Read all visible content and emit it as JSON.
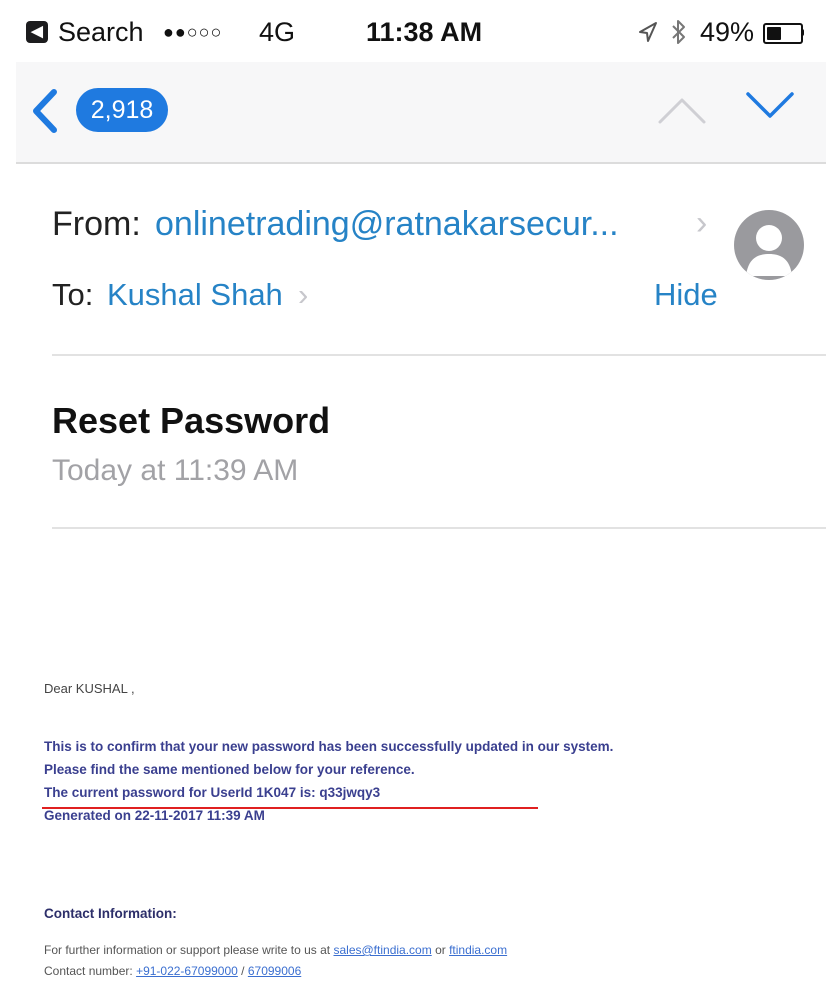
{
  "status_bar": {
    "back_app_glyph": "◀",
    "back_app_label": "Search",
    "signal_dots": "●●○○○",
    "network": "4G",
    "time": "11:38 AM",
    "battery_percent": "49%",
    "battery_level": 0.49,
    "icons": [
      "location-arrow-icon",
      "bluetooth-icon",
      "battery-icon"
    ]
  },
  "nav": {
    "back_count": "2,918",
    "icons": [
      "back-chevron-icon",
      "up-chevron-icon",
      "down-chevron-icon"
    ]
  },
  "email": {
    "from_label": "From:",
    "from_address": "onlinetrading@ratnakarsecur...",
    "from_chevron": "›",
    "to_label": "To:",
    "to_name": "Kushal Shah",
    "to_chevron": "›",
    "hide_label": "Hide",
    "subject": "Reset Password",
    "date": "Today at 11:39 AM",
    "body": {
      "greeting": "Dear KUSHAL ,",
      "lines": [
        "This is to confirm that your new password has been successfully updated in our system.",
        "Please find the same mentioned below for your reference.",
        "The current password for UserId 1K047 is: q33jwqy3",
        "Generated on 22-11-2017 11:39 AM"
      ],
      "contact_title": "Contact Information:",
      "support_prefix": "For further information or support please write to us at",
      "support_email": "sales@ftindia.com",
      "support_or": "or",
      "support_site": "ftindia.com",
      "contact_prefix": "Contact number:",
      "phone1": "+91-022-67099000",
      "phone_sep": "/",
      "phone2": "67099006"
    }
  },
  "colors": {
    "accent": "#2683c6",
    "badge": "#1f7ae0",
    "body_text": "#3a3f8f",
    "underline": "#e02020"
  }
}
